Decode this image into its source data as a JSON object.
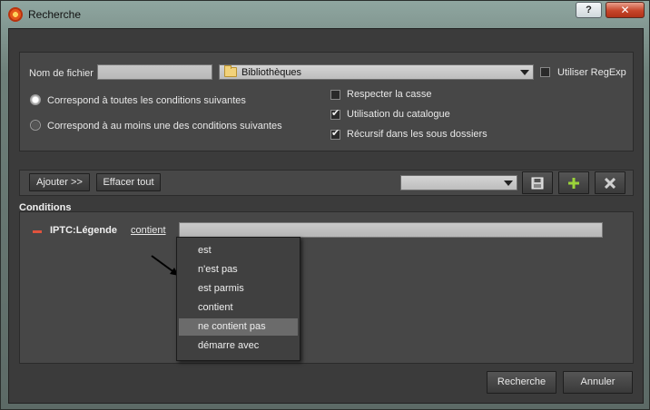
{
  "window": {
    "title": "Recherche",
    "help_label": "?",
    "close_label": "✕"
  },
  "options": {
    "filename_label": "Nom de fichier",
    "filename_value": "",
    "location_selected": "Bibliothèques",
    "regexp_label": "Utiliser RegExp",
    "regexp_checked": false,
    "match_all_label": "Correspond à toutes les conditions suivantes",
    "match_any_label": "Correspond à au moins une des conditions suivantes",
    "case_label": "Respecter la casse",
    "case_checked": false,
    "catalog_label": "Utilisation du catalogue",
    "catalog_checked": true,
    "recursive_label": "Récursif dans les sous dossiers",
    "recursive_checked": true
  },
  "toolbar": {
    "add_label": "Ajouter >>",
    "clear_label": "Effacer tout",
    "preset_selected": "",
    "save_icon": "save-icon",
    "add_icon": "plus-icon",
    "delete_icon": "close-icon"
  },
  "conditions": {
    "title": "Conditions",
    "rows": [
      {
        "field": "IPTC:Légende",
        "operator": "contient",
        "value": ""
      }
    ]
  },
  "operator_menu": {
    "items": [
      {
        "label": "est"
      },
      {
        "label": "n'est pas"
      },
      {
        "label": "est parmis"
      },
      {
        "label": "contient"
      },
      {
        "label": "ne contient pas"
      },
      {
        "label": "démarre avec"
      }
    ],
    "hovered_index": 4
  },
  "footer": {
    "search_label": "Recherche",
    "cancel_label": "Annuler"
  },
  "colors": {
    "accent_green": "#9bd43a",
    "remove_red": "#e0533d",
    "panel_bg": "#474747"
  }
}
